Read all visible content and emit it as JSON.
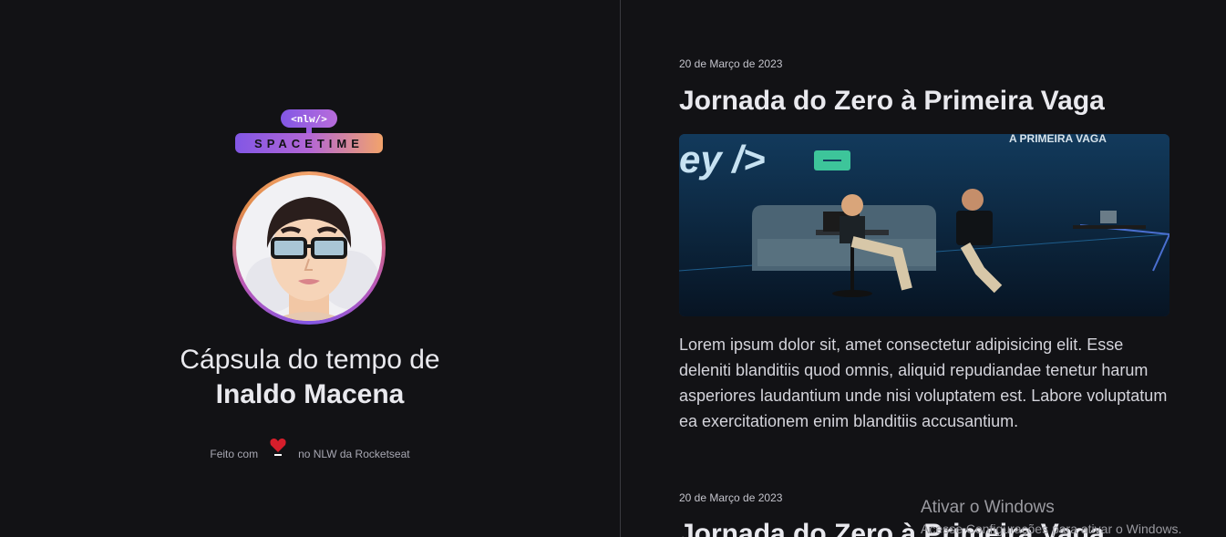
{
  "logo": {
    "code_text": "<nlw/>",
    "name_text": "SPACETIME"
  },
  "profile": {
    "title_prefix": "Cápsula do tempo de",
    "name": "Inaldo Macena",
    "footer_before": "Feito com",
    "footer_after": "no NLW da Rocketseat"
  },
  "posts": [
    {
      "date": "20 de Março de 2023",
      "title": "Jornada do Zero à Primeira Vaga",
      "image_text_left": "ey />",
      "image_text_right": "A PRIMEIRA VAGA",
      "body": "Lorem ipsum dolor sit, amet consectetur adipisicing elit. Esse deleniti blanditiis quod omnis, aliquid repudiandae tenetur harum asperiores laudantium unde nisi voluptatem est. Labore voluptatum ea exercitationem enim blanditiis accusantium."
    },
    {
      "date": "20 de Março de 2023",
      "title": "Jornada do Zero à Primeira Vaga"
    }
  ],
  "watermark": {
    "title": "Ativar o Windows",
    "subtitle": "Acesse Configurações para ativar o Windows."
  },
  "colors": {
    "background": "#121215",
    "text": "#e1e1e6",
    "accent_purple": "#8257e5",
    "accent_orange": "#f2a36b"
  }
}
